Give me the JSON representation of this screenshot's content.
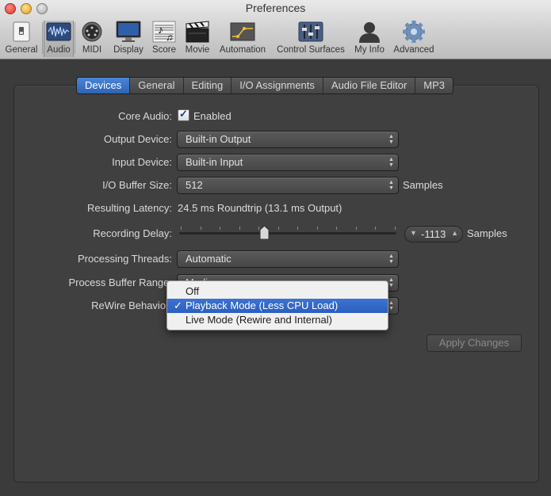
{
  "window": {
    "title": "Preferences"
  },
  "toolbar": {
    "items": [
      {
        "label": "General",
        "icon": "switch-icon"
      },
      {
        "label": "Audio",
        "icon": "waveform-icon",
        "selected": true
      },
      {
        "label": "MIDI",
        "icon": "midi-connector-icon"
      },
      {
        "label": "Display",
        "icon": "monitor-icon"
      },
      {
        "label": "Score",
        "icon": "music-score-icon"
      },
      {
        "label": "Movie",
        "icon": "clapperboard-icon"
      },
      {
        "label": "Automation",
        "icon": "automation-curve-icon"
      },
      {
        "label": "Control Surfaces",
        "icon": "faders-icon"
      },
      {
        "label": "My Info",
        "icon": "user-silhouette-icon"
      },
      {
        "label": "Advanced",
        "icon": "gear-icon"
      }
    ]
  },
  "tabs": [
    {
      "label": "Devices",
      "active": true
    },
    {
      "label": "General"
    },
    {
      "label": "Editing"
    },
    {
      "label": "I/O Assignments"
    },
    {
      "label": "Audio File Editor"
    },
    {
      "label": "MP3"
    }
  ],
  "form": {
    "core_audio": {
      "label": "Core Audio:",
      "checkbox_label": "Enabled",
      "checked": true
    },
    "output_device": {
      "label": "Output Device:",
      "value": "Built-in Output"
    },
    "input_device": {
      "label": "Input Device:",
      "value": "Built-in Input"
    },
    "buffer_size": {
      "label": "I/O Buffer Size:",
      "value": "512",
      "unit": "Samples"
    },
    "latency": {
      "label": "Resulting Latency:",
      "value": "24.5 ms Roundtrip (13.1 ms Output)"
    },
    "recording_delay": {
      "label": "Recording Delay:",
      "value": "-1113",
      "unit": "Samples",
      "slider_fraction": 0.39
    },
    "processing_threads": {
      "label": "Processing Threads:",
      "value": "Automatic"
    },
    "process_buffer_range": {
      "label": "Process Buffer Range:",
      "value": "Medium"
    },
    "rewire": {
      "label": "ReWire Behavior:"
    }
  },
  "dropdown": {
    "options": [
      {
        "label": "Off",
        "checked": false,
        "highlighted": false
      },
      {
        "label": "Playback Mode (Less CPU Load)",
        "checked": true,
        "highlighted": true
      },
      {
        "label": "Live Mode (Rewire and Internal)",
        "checked": false,
        "highlighted": false
      }
    ],
    "check_glyph": "✓"
  },
  "apply_button": {
    "label": "Apply Changes",
    "enabled": false
  },
  "colors": {
    "accent": "#3a6fcf",
    "background": "#3b3b3b",
    "panel": "#404040"
  }
}
